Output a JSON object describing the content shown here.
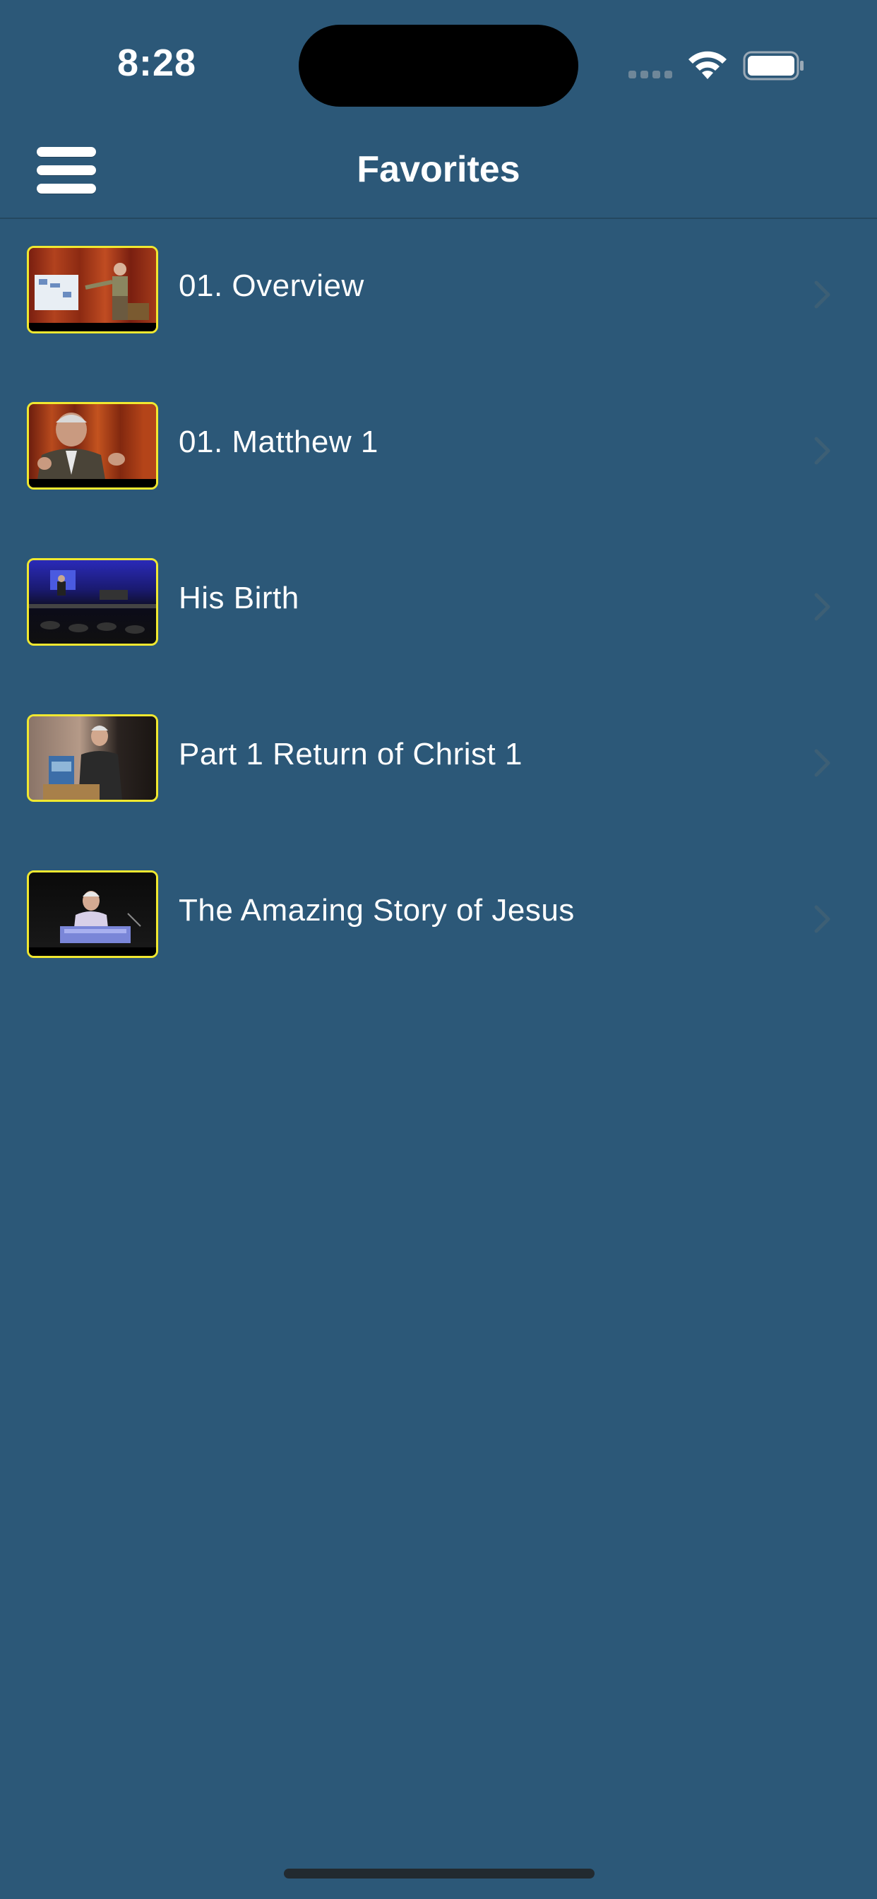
{
  "status_bar": {
    "time": "8:28"
  },
  "header": {
    "title": "Favorites",
    "menu_icon": "hamburger-menu-icon"
  },
  "favorites": [
    {
      "title": "01. Overview"
    },
    {
      "title": "01. Matthew 1"
    },
    {
      "title": "His Birth"
    },
    {
      "title": "Part 1 Return of Christ 1"
    },
    {
      "title": "The Amazing Story of Jesus"
    }
  ],
  "colors": {
    "background": "#2c5878",
    "thumbnail_border": "#f0e830",
    "chevron": "#3d5f75"
  }
}
